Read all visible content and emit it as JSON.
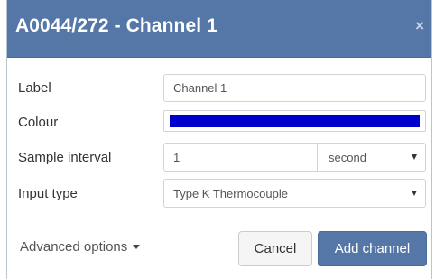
{
  "dialog": {
    "title": "A0044/272 - Channel 1",
    "close_symbol": "×",
    "close_icon": "close-icon"
  },
  "form": {
    "label": {
      "label": "Label",
      "value": "Channel 1"
    },
    "colour": {
      "label": "Colour",
      "value": "#0000cc"
    },
    "sample_interval": {
      "label": "Sample interval",
      "value": "1",
      "unit": "second"
    },
    "input_type": {
      "label": "Input type",
      "value": "Type K Thermocouple"
    }
  },
  "footer": {
    "advanced_options": "Advanced options",
    "cancel_label": "Cancel",
    "add_label": "Add channel"
  },
  "colors": {
    "header": "#5577a8",
    "primary_button": "#5577a8",
    "channel_colour": "#0000cc"
  }
}
